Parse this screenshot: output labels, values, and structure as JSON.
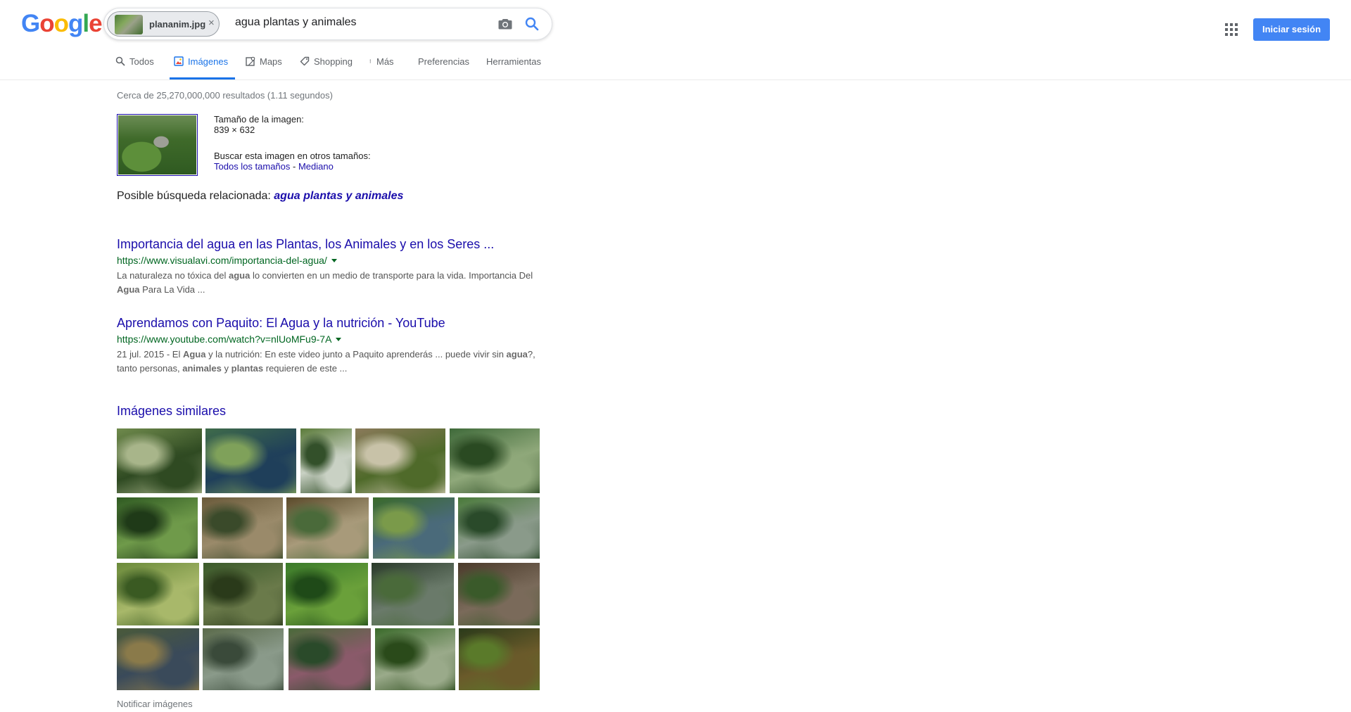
{
  "header": {
    "logo_letters": [
      {
        "ch": "G",
        "color": "#4285f4"
      },
      {
        "ch": "o",
        "color": "#ea4335"
      },
      {
        "ch": "o",
        "color": "#fbbc05"
      },
      {
        "ch": "g",
        "color": "#4285f4"
      },
      {
        "ch": "l",
        "color": "#34a853"
      },
      {
        "ch": "e",
        "color": "#ea4335"
      }
    ],
    "image_chip_name": "plananim.jpg",
    "chip_close": "×",
    "query": "agua plantas y animales",
    "signin_label": "Iniciar sesión"
  },
  "tabs": [
    {
      "label": "Todos",
      "icon": "search-icon"
    },
    {
      "label": "Imágenes",
      "icon": "image-icon",
      "active": true
    },
    {
      "label": "Maps",
      "icon": "map-icon"
    },
    {
      "label": "Shopping",
      "icon": "tag-icon"
    },
    {
      "label": "Más",
      "icon": "more-vert-icon"
    },
    {
      "label": "Preferencias"
    },
    {
      "label": "Herramientas"
    }
  ],
  "results_stats": "Cerca de 25,270,000,000 resultados (1.11 segundos)",
  "image_info": {
    "size_label": "Tamaño de la imagen:",
    "size_value": "839 × 632",
    "other_sizes_label": "Buscar esta imagen en otros tamaños:",
    "all_sizes_link": "Todos los tamaños",
    "separator": " - ",
    "medium_link": "Mediano"
  },
  "related": {
    "prefix": "Posible búsqueda relacionada: ",
    "link": "agua plantas y animales"
  },
  "results": [
    {
      "title": "Importancia del agua en las Plantas, los Animales y en los Seres ...",
      "url": "https://www.visualavi.com/importancia-del-agua/",
      "snippet_line1": [
        {
          "t": "La naturaleza no tóxica del ",
          "b": false
        },
        {
          "t": "agua",
          "b": true
        },
        {
          "t": " lo convierten en un medio de transporte para la vida. Importancia Del",
          "b": false
        }
      ],
      "snippet_line2": [
        {
          "t": "Agua",
          "b": true
        },
        {
          "t": " Para La Vida ...",
          "b": false
        }
      ]
    },
    {
      "title": "Aprendamos con Paquito: El Agua y la nutrición - YouTube",
      "url": "https://www.youtube.com/watch?v=nlUoMFu9-7A",
      "snippet_line1": [
        {
          "t": "21 jul. 2015 - El ",
          "b": false
        },
        {
          "t": "Agua",
          "b": true
        },
        {
          "t": " y la nutrición: En este video junto a Paquito aprenderás ... puede vivir sin ",
          "b": false
        },
        {
          "t": "agua",
          "b": true
        },
        {
          "t": "?,",
          "b": false
        }
      ],
      "snippet_line2": [
        {
          "t": "tanto personas, ",
          "b": false
        },
        {
          "t": "animales",
          "b": true
        },
        {
          "t": " y ",
          "b": false
        },
        {
          "t": "plantas",
          "b": true
        },
        {
          "t": " requieren de este ...",
          "b": false
        }
      ]
    }
  ],
  "similar_images_heading": "Imágenes similares",
  "similar_images": [
    [
      {
        "c1": "#6f8a4c",
        "c2": "#2f4a22",
        "c3": "#a8b58a"
      },
      {
        "c1": "#3f6b4a",
        "c2": "#1f3f5a",
        "c3": "#7fa15a"
      },
      {
        "c1": "#5b7b3a",
        "c2": "#c9d1c4",
        "c3": "#33502a"
      },
      {
        "c1": "#8a7a5a",
        "c2": "#4f6a2a",
        "c3": "#c8c2a8"
      },
      {
        "c1": "#3f6a3a",
        "c2": "#8fa87a",
        "c3": "#2a4a22"
      }
    ],
    [
      {
        "c1": "#2f5a22",
        "c2": "#6f9a4a",
        "c3": "#1f3a18"
      },
      {
        "c1": "#6a5a3a",
        "c2": "#9a8a6a",
        "c3": "#3a4a2a"
      },
      {
        "c1": "#5a4a2a",
        "c2": "#a89a7a",
        "c3": "#4a6a3a"
      },
      {
        "c1": "#3a6a2a",
        "c2": "#4a6a7a",
        "c3": "#7a9a4a"
      },
      {
        "c1": "#4a7a3a",
        "c2": "#8a9a8a",
        "c3": "#2a4a2a"
      }
    ],
    [
      {
        "c1": "#6a8a3a",
        "c2": "#a8b86a",
        "c3": "#3a5a22"
      },
      {
        "c1": "#3a5a2a",
        "c2": "#6a7a4a",
        "c3": "#2a3a1a"
      },
      {
        "c1": "#3a7a2a",
        "c2": "#6aa03a",
        "c3": "#1f4a18"
      },
      {
        "c1": "#2a3a2a",
        "c2": "#6a7a6a",
        "c3": "#4a6a3a"
      },
      {
        "c1": "#4a3a2a",
        "c2": "#7a6a5a",
        "c3": "#3a5a2a"
      }
    ],
    [
      {
        "c1": "#4a5a3a",
        "c2": "#3a4a5a",
        "c3": "#8a7a4a"
      },
      {
        "c1": "#5a6a4a",
        "c2": "#8a9a8a",
        "c3": "#3a4a3a"
      },
      {
        "c1": "#4a6a3a",
        "c2": "#8a5a6a",
        "c3": "#2a4a2a"
      },
      {
        "c1": "#3a6a2a",
        "c2": "#9aaa8a",
        "c3": "#2a4a1a"
      },
      {
        "c1": "#2a3a1a",
        "c2": "#6a5a2a",
        "c3": "#5a7a2a"
      }
    ]
  ],
  "report_images_label": "Notificar imágenes"
}
